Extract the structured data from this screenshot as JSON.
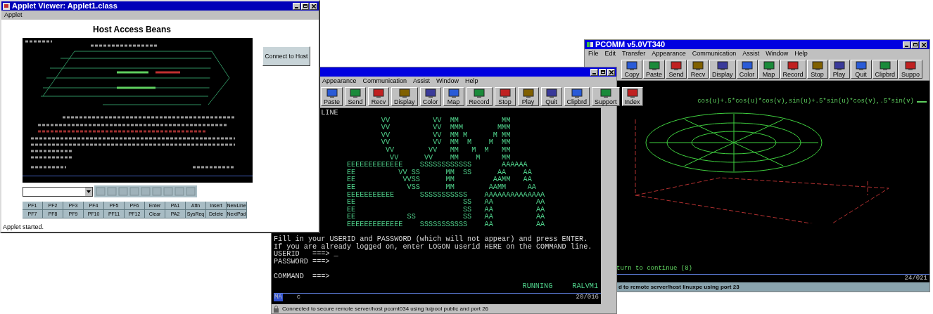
{
  "applet_window": {
    "title": "Applet Viewer: Applet1.class",
    "menu": [
      "Applet"
    ],
    "heading": "Host Access Beans",
    "connect_button": "Connect to Host",
    "keys": [
      [
        "PF1",
        "PF2",
        "PF3",
        "PF4",
        "PF5",
        "PF6",
        "Enter",
        "PA1",
        "Attn",
        "Insert",
        "NewLine"
      ],
      [
        "PF7",
        "PF8",
        "PF9",
        "PF10",
        "PF11",
        "PF12",
        "Clear",
        "PA2",
        "SysReq",
        "Delete",
        "NextPad"
      ]
    ],
    "status_bar": "Applet started."
  },
  "session_window": {
    "menu": [
      "Appearance",
      "Communication",
      "Assist",
      "Window",
      "Help"
    ],
    "toolbar": [
      "Paste",
      "Send",
      "Recv",
      "Display",
      "Color",
      "Map",
      "Record",
      "Stop",
      "Play",
      "Quit",
      "Clipbrd",
      "Support",
      "Index"
    ],
    "terminal_lines": [
      "           LINE",
      "                         VV          VV  MM          MM",
      "                         VV          VV  MMM        MMM",
      "                         VV          VV  MM M      M MM",
      "                         VV          VV  MM  M    M  MM",
      "                          VV        VV   MM   M  M   MM",
      "                           VV      VV    MM    M     MM",
      "                 EEEEEEEEEEEEE    SSSSSSSSSSSS       AAAAAA",
      "                 EE          VV SS      MM  SS      AA    AA",
      "                 EE           VVSS      MM         AAMM   AA",
      "                 EE            VSS      MM        AAMM     AA",
      "                 EEEEEEEEEEE      SSSSSSSSSSS    AAAAAAAAAAAAAA",
      "                 EE                         SS   AA          AA",
      "                 EE                         SS   AA          AA",
      "                 EE            SS           SS   AA          AA",
      "                 EEEEEEEEEEEEE    SSSSSSSSSSS    AA          AA"
    ],
    "login_lines": [
      "Fill in your USERID and PASSWORD (which will not appear) and press ENTER.",
      "If you are already logged on, enter LOGON userid HERE on the COMMAND line.",
      "USERID   ===> _",
      "PASSWORD ===>"
    ],
    "command_line": "COMMAND  ===>",
    "run_status": "RUNNING",
    "system": "RALVM1",
    "oia_left": "MA",
    "oia_mid": "c",
    "oia_right": "20/016",
    "status_bar": "Connected to secure remote server/host pcomt034 using lu/pool public and port 26"
  },
  "pcomm_window": {
    "title": "PCOMM v5.0VT340",
    "menu": [
      "File",
      "Edit",
      "Transfer",
      "Appearance",
      "Communication",
      "Assist",
      "Window",
      "Help"
    ],
    "toolbar": [
      "Copy",
      "Paste",
      "Send",
      "Recv",
      "Display",
      "Color",
      "Map",
      "Record",
      "Stop",
      "Play",
      "Quit",
      "Clipbrd",
      "Suppo"
    ],
    "formula": "cos(u)+.5*cos(u)*cos(v),sin(u)+.5*sin(u)*cos(v),.5*sin(v)",
    "prompt": "turn to continue (8)",
    "oia_right": "24/021",
    "status_bar": "d to remote server/host linuxpc using port 23"
  }
}
